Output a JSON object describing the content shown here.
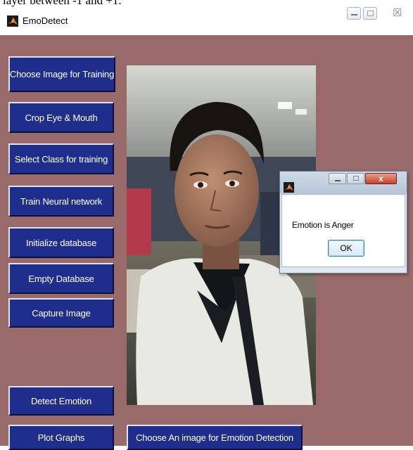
{
  "top_caption": "layer between -1 and +1.",
  "window": {
    "title": "EmoDetect",
    "close_glyph": "☒",
    "icon": "matlab-logo-icon"
  },
  "buttons": {
    "choose_image_training": "Choose Image for Training",
    "crop": "Crop Eye & Mouth",
    "select_class": "Select Class for training",
    "train": "Train Neural network",
    "init_db": "Initialize database",
    "empty_db": "Empty Database",
    "capture": "Capture Image",
    "detect": "Detect Emotion",
    "plot": "Plot Graphs",
    "choose_image_detection": "Choose An image for Emotion Detection"
  },
  "dialog": {
    "message": "Emotion is Anger",
    "ok_label": "OK",
    "close_glyph": "x"
  },
  "colors": {
    "panel_background": "#986a6a",
    "button_background": "#1f2d8c",
    "button_text": "#ffffff"
  }
}
